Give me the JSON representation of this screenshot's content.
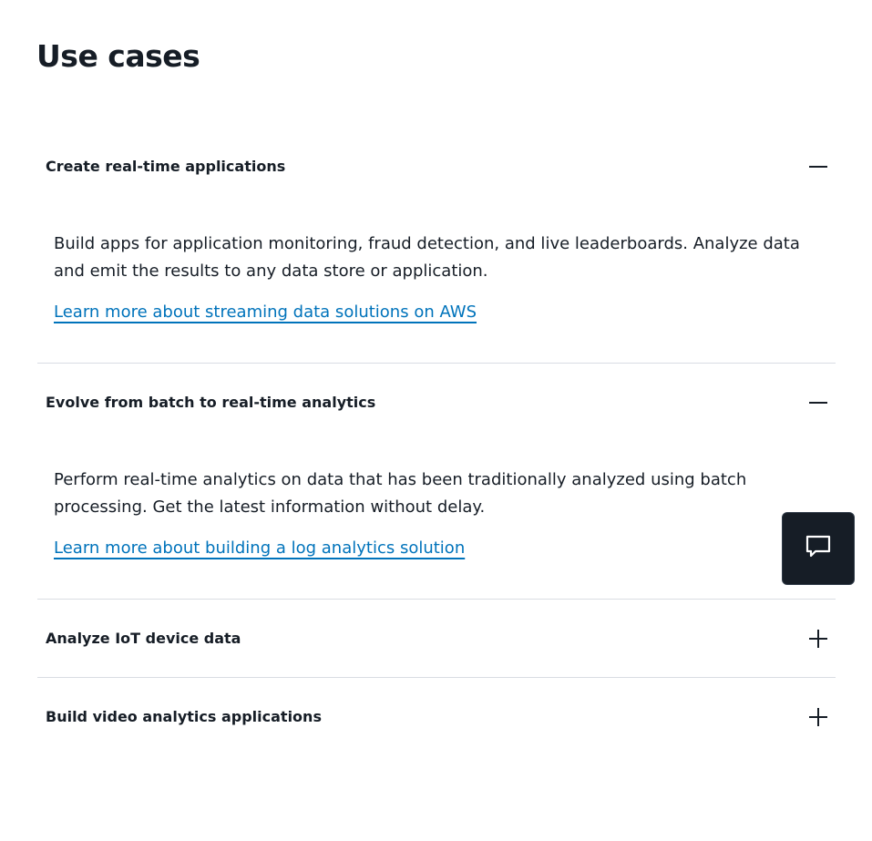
{
  "page": {
    "title": "Use cases"
  },
  "accordion": {
    "items": [
      {
        "title": "Create real-time applications",
        "expanded": true,
        "description": "Build apps for application monitoring, fraud detection, and live leaderboards. Analyze data and emit the results to any data store or application.",
        "link_label": "Learn more about streaming data solutions on AWS",
        "toggle_icon": "minus-icon"
      },
      {
        "title": "Evolve from batch to real-time analytics",
        "expanded": true,
        "description": "Perform real-time analytics on data that has been traditionally analyzed using batch processing. Get the latest information without delay.",
        "link_label": "Learn more about building a log analytics solution",
        "toggle_icon": "minus-icon"
      },
      {
        "title": "Analyze IoT device data",
        "expanded": false,
        "toggle_icon": "plus-icon"
      },
      {
        "title": "Build video analytics applications",
        "expanded": false,
        "toggle_icon": "plus-icon"
      }
    ]
  },
  "chat": {
    "icon": "chat-bubble-icon"
  },
  "colors": {
    "text": "#161d26",
    "link": "#0073bb",
    "divider": "#d9dde3",
    "chat_background": "#161d26"
  }
}
